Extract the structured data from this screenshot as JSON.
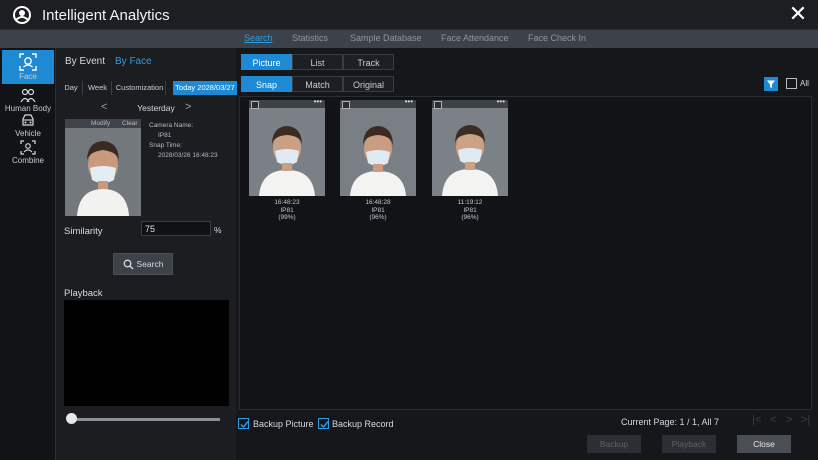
{
  "app": {
    "title": "Intelligent Analytics",
    "close_label": "✕"
  },
  "topnav": {
    "tabs": [
      {
        "label": "Search"
      },
      {
        "label": "Statistics"
      },
      {
        "label": "Sample Database"
      },
      {
        "label": "Face Attendance"
      },
      {
        "label": "Face Check In"
      }
    ],
    "active": "Search"
  },
  "sidebar": {
    "items": [
      {
        "label": "Face",
        "icon": "face-scan-icon"
      },
      {
        "label": "Human Body",
        "icon": "human-body-icon"
      },
      {
        "label": "Vehicle",
        "icon": "vehicle-icon"
      },
      {
        "label": "Combine",
        "icon": "combine-icon"
      }
    ],
    "active": "Face"
  },
  "left": {
    "event_tabs": {
      "by_event": "By Event",
      "by_face": "By Face"
    },
    "ranges": {
      "day": "Day",
      "week": "Week",
      "customization": "Customization",
      "today": "Today 2028/03/27"
    },
    "day_nav": {
      "prev": "<",
      "label": "Yesterday",
      "next": ">"
    },
    "face": {
      "modify": "Modify",
      "clear": "Clear"
    },
    "camera": {
      "name_label": "Camera Name:",
      "name": "IP81",
      "time_label": "Snap Time:",
      "time": "2028/03/26 16:48:23"
    },
    "similarity": {
      "label": "Similarity",
      "value": "75",
      "unit": "%"
    },
    "search_label": "Search",
    "playback_label": "Playback"
  },
  "views": {
    "mode": {
      "picture": "Picture",
      "list": "List",
      "track": "Track"
    },
    "sub": {
      "snap": "Snap",
      "match": "Match",
      "original": "Original"
    },
    "all_label": "All"
  },
  "results": [
    {
      "time": "16:48:23",
      "camera": "IP81",
      "score": "(99%)"
    },
    {
      "time": "16:48:28",
      "camera": "IP81",
      "score": "(96%)"
    },
    {
      "time": "11:19:12",
      "camera": "IP81",
      "score": "(96%)"
    }
  ],
  "footer": {
    "backup_picture": "Backup Picture",
    "backup_record": "Backup Record",
    "page_info": "Current Page: 1 / 1, All 7",
    "buttons": {
      "backup": "Backup",
      "playback": "Playback",
      "close": "Close"
    }
  },
  "colors": {
    "accent": "#1e8ad3",
    "background": "#15171b"
  }
}
